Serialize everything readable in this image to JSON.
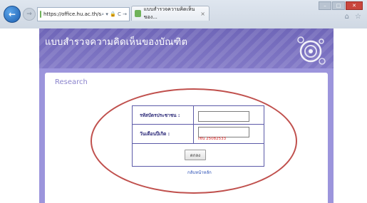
{
  "browser": {
    "address": "https://office.hu.ac.th/s",
    "address_controls": "⌕ ▾ 🔒 C →",
    "tab_title": "แบบสำรวจความคิดเห็นของ...",
    "tab_close": "×",
    "window_buttons": [
      "–",
      "□",
      "✕"
    ],
    "toolbar_icons": [
      "⌂",
      "☆"
    ]
  },
  "page": {
    "header_title": "แบบสำรวจความคิดเห็นของบัณฑิต",
    "section_title": "Research",
    "form": {
      "id_label": "รหัสบัตรประชาชน :",
      "id_value": "",
      "dob_label": "วันเดือนปีเกิด :",
      "dob_value": "",
      "dob_hint": "เช่น 25082533",
      "submit_label": "ตกลง"
    },
    "back_link": "กลับหน้าหลัก"
  },
  "colors": {
    "header_purple": "#6f66b8",
    "page_bg": "#9c95dc",
    "annotation_ellipse": "#c0504d"
  }
}
